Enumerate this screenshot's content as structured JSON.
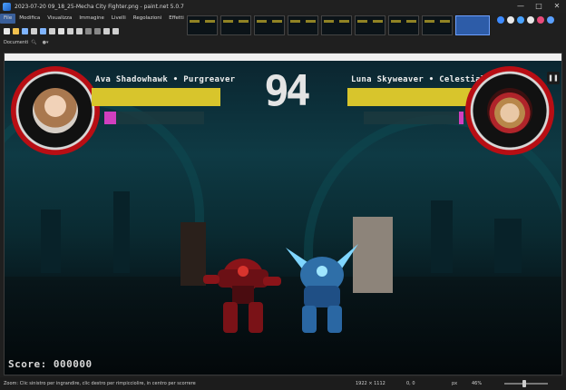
{
  "window": {
    "title": "2023-07-20 09_18_25-Mecha City Fighter.png - paint.net 5.0.7",
    "controls": [
      "—",
      "□",
      "✕"
    ]
  },
  "menu": {
    "items": [
      "File",
      "Modifica",
      "Visualizza",
      "Immagine",
      "Livelli",
      "Regolazioni",
      "Effetti"
    ]
  },
  "toolbar": {
    "documents_label": "Documenti",
    "tool_colors": [
      "#e8e8e8",
      "#f2c14e",
      "#7fb4ff",
      "#cfcfcf",
      "#7fb4ff",
      "#cfcfcf",
      "#e0e0e0",
      "#cfcfcf",
      "#cfcfcf",
      "#888888",
      "#888888",
      "#cfcfcf",
      "#cfcfcf"
    ]
  },
  "right_icons": [
    "#3d8bff",
    "#e8e8e8",
    "#4aa3ff",
    "#e8e8e8",
    "#e84a7a",
    "#5aa0ff"
  ],
  "image_window": {
    "title": "Mecha City Fighter"
  },
  "game": {
    "player_left": {
      "name": "Ava Shadowhawk • Purgreaver",
      "health": 0.9,
      "energy": 0.12
    },
    "player_right": {
      "name": "Luna Skyweaver • Celestial Seraph",
      "health": 0.9,
      "energy": 0.05
    },
    "timer": "94",
    "pause_icon": "❚❚",
    "score_label": "Score: 000000"
  },
  "statusbar": {
    "hint": "Zoom: Clic sinistro per ingrandire, clic destro per rimpicciolire, in centro per scorrere",
    "image_size": "1922 × 1112",
    "selection": "0, 0",
    "unit": "px",
    "zoom": "46%",
    "zoom_level": 0.46
  }
}
